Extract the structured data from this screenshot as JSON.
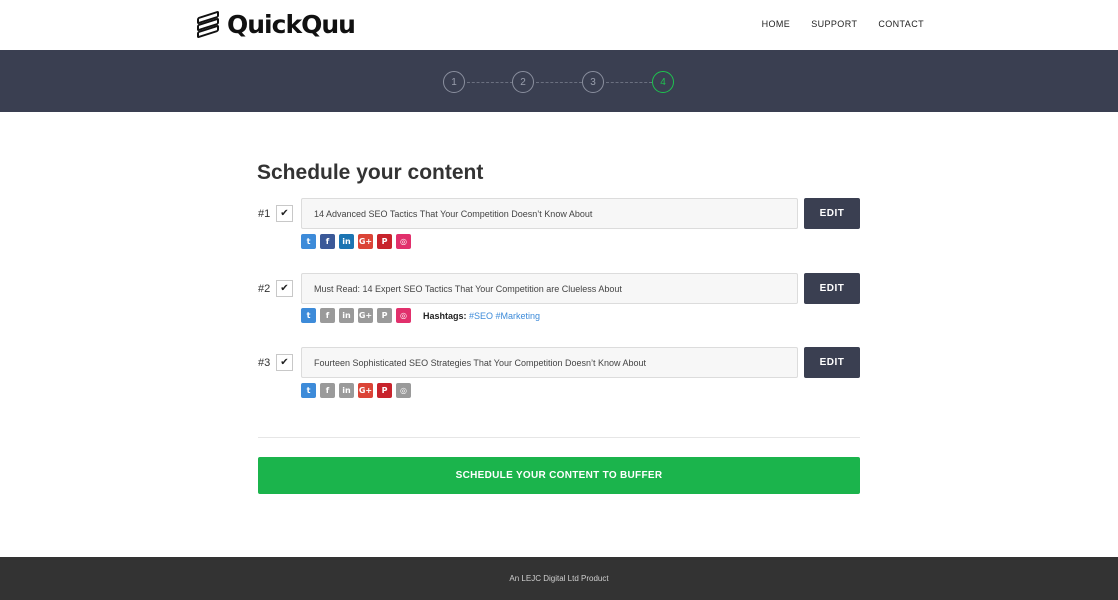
{
  "header": {
    "logo_text": "QuickQuu",
    "nav": [
      "HOME",
      "SUPPORT",
      "CONTACT"
    ]
  },
  "steps": [
    "1",
    "2",
    "3",
    "4"
  ],
  "active_step": "4",
  "main": {
    "title": "Schedule your content",
    "edit_label": "EDIT",
    "check_glyph": "✔",
    "rows": [
      {
        "num": "#1",
        "text": "14 Advanced SEO Tactics That Your Competition Doesn’t Know About",
        "networks": {
          "twitter": true,
          "facebook": true,
          "linkedin": true,
          "gplus": true,
          "pinterest": true,
          "instagram": true
        }
      },
      {
        "num": "#2",
        "text": "Must Read: 14 Expert SEO Tactics That Your Competition are Clueless About",
        "networks": {
          "twitter": true,
          "facebook": false,
          "linkedin": false,
          "gplus": false,
          "pinterest": false,
          "instagram": true
        },
        "hashtags_label": "Hashtags:",
        "hashtags": "#SEO #Marketing"
      },
      {
        "num": "#3",
        "text": "Fourteen Sophisticated SEO Strategies That Your Competition Doesn’t Know About",
        "networks": {
          "twitter": true,
          "facebook": false,
          "linkedin": false,
          "gplus": true,
          "pinterest": true,
          "instagram": false
        }
      }
    ],
    "schedule_button": "SCHEDULE YOUR CONTENT TO BUFFER"
  },
  "icon_glyphs": {
    "twitter": "t",
    "facebook": "f",
    "linkedin": "in",
    "gplus": "G+",
    "pinterest": "P",
    "instagram": "◎"
  },
  "colors": {
    "band": "#3a3f51",
    "accent_green": "#1bb44c",
    "link_blue": "#3d8bd9",
    "footer": "#333333"
  },
  "footer": {
    "text": "An LEJC Digital Ltd Product"
  }
}
